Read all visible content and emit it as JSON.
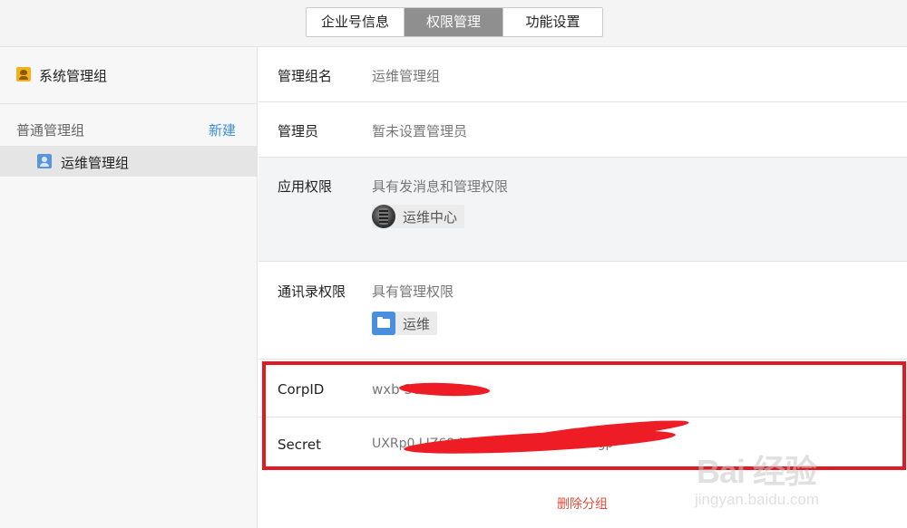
{
  "tabs": [
    {
      "label": "企业号信息",
      "active": false
    },
    {
      "label": "权限管理",
      "active": true
    },
    {
      "label": "功能设置",
      "active": false
    }
  ],
  "sidebar": {
    "system_group": {
      "label": "系统管理组",
      "icon": "admin-group-icon"
    },
    "normal_group_title": "普通管理组",
    "new_label": "新建",
    "items": [
      {
        "label": "运维管理组",
        "icon": "user-icon",
        "selected": true
      }
    ]
  },
  "details": {
    "group_name": {
      "key": "管理组名",
      "value": "运维管理组"
    },
    "admins": {
      "key": "管理员",
      "value": "暂未设置管理员"
    },
    "app_permission": {
      "key": "应用权限",
      "value": "具有发消息和管理权限",
      "app": {
        "label": "运维中心",
        "icon": "app-avatar-icon"
      }
    },
    "contacts_permission": {
      "key": "通讯录权限",
      "value": "具有管理权限",
      "dept": {
        "label": "运维",
        "icon": "folder-icon"
      }
    },
    "corpid": {
      "key": "CorpID",
      "value": "wxb                    3cf281"
    },
    "secret": {
      "key": "Secret",
      "value": "UXRp0                                                               LIZ68dX43WXJHeXjTAWTrR2gp"
    }
  },
  "delete_label": "删除分组",
  "watermark": {
    "main": "Bai 经验",
    "sub": "jingyan.baidu.com"
  },
  "colors": {
    "accent_blue": "#3b8ce0",
    "active_tab": "#8f8f8f",
    "highlight_red": "#e01a22",
    "delete_red": "#e44c3a"
  }
}
